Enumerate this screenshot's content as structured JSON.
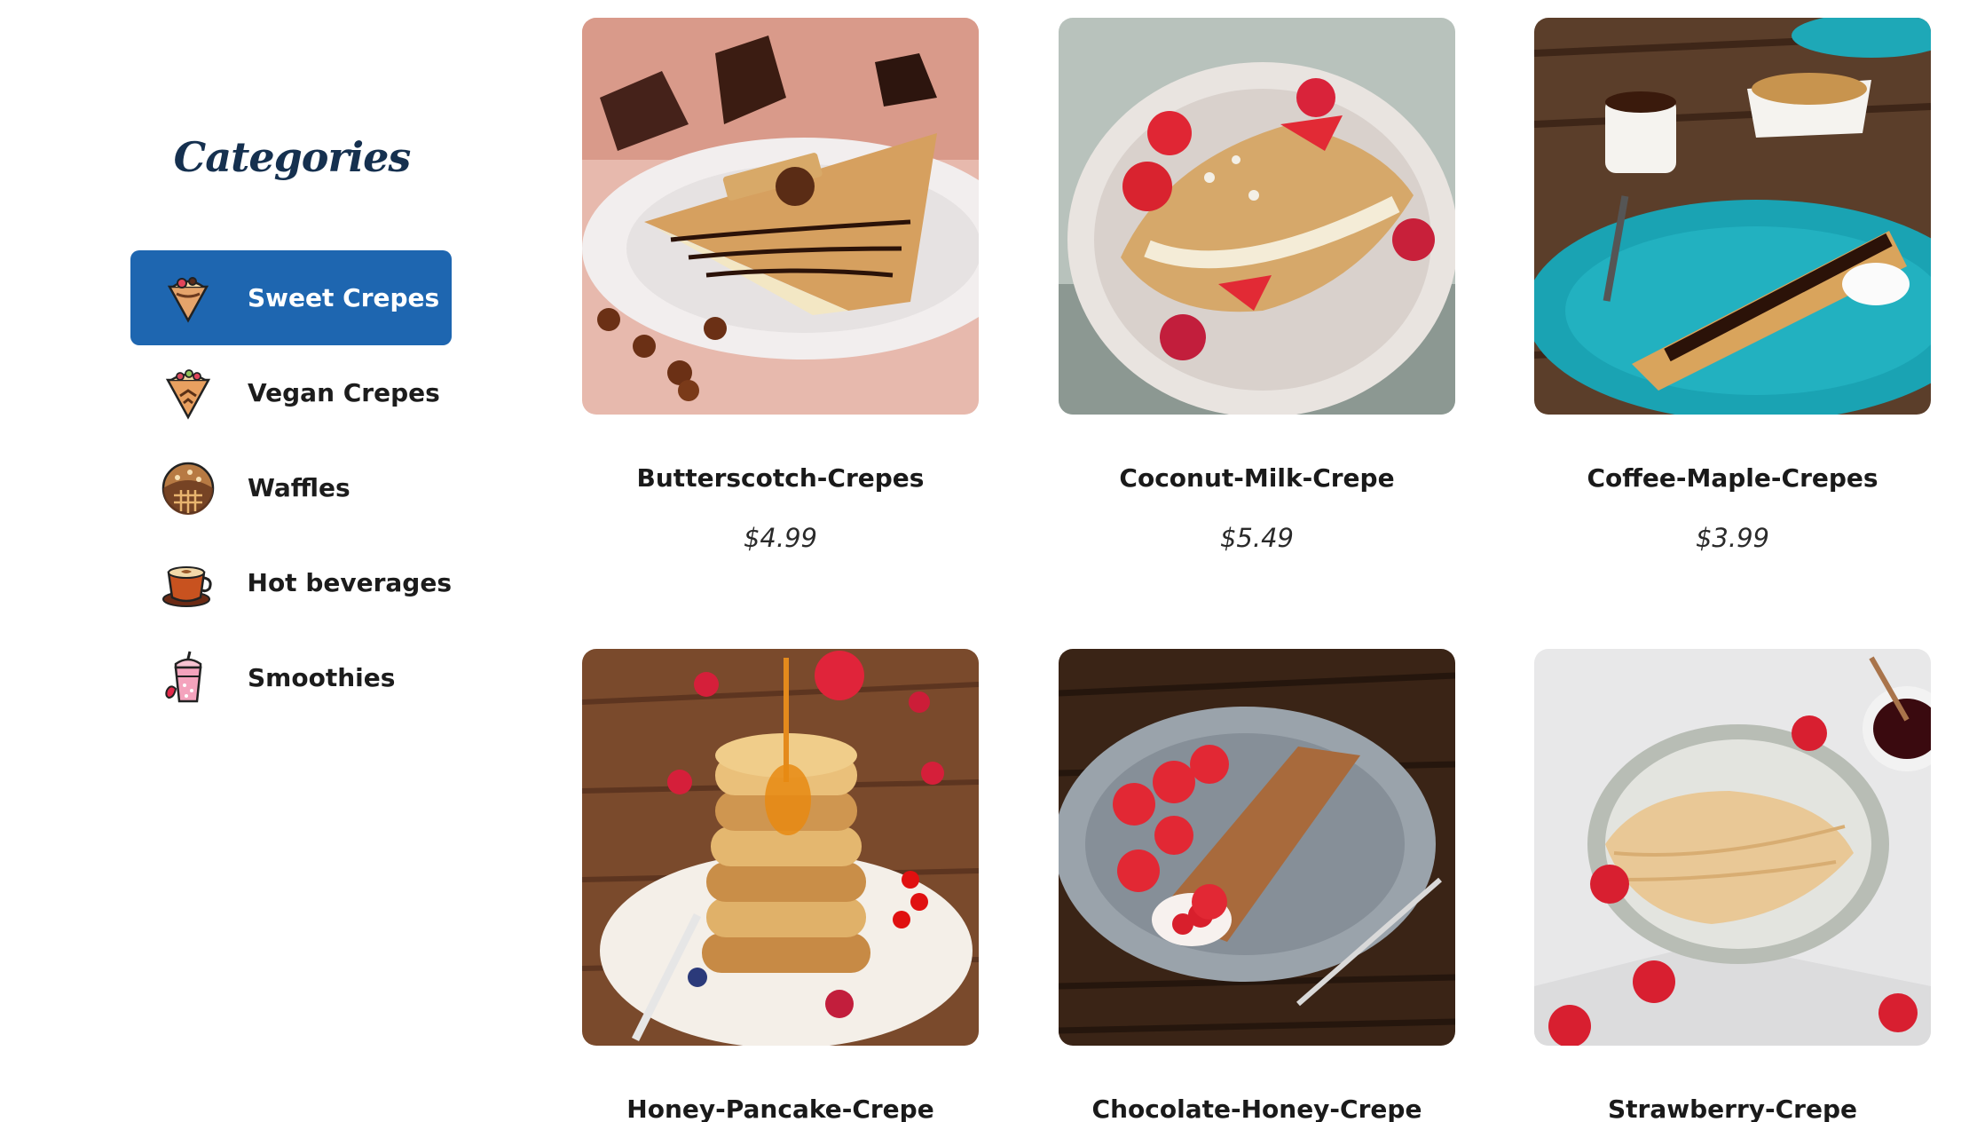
{
  "sidebar": {
    "title": "Categories",
    "items": [
      {
        "label": "Sweet Crepes",
        "icon": "sweet-crepe-icon",
        "active": true
      },
      {
        "label": "Vegan Crepes",
        "icon": "vegan-crepe-icon",
        "active": false
      },
      {
        "label": "Waffles",
        "icon": "waffle-icon",
        "active": false
      },
      {
        "label": "Hot beverages",
        "icon": "hot-beverage-icon",
        "active": false
      },
      {
        "label": "Smoothies",
        "icon": "smoothie-icon",
        "active": false
      }
    ]
  },
  "products": [
    {
      "name": "Butterscotch-Crepes",
      "price": "$4.99"
    },
    {
      "name": "Coconut-Milk-Crepe",
      "price": "$5.49"
    },
    {
      "name": "Coffee-Maple-Crepes",
      "price": "$3.99"
    },
    {
      "name": "Honey-Pancake-Crepe",
      "price": ""
    },
    {
      "name": "Chocolate-Honey-Crepe",
      "price": ""
    },
    {
      "name": "Strawberry-Crepe",
      "price": ""
    }
  ],
  "colors": {
    "active_category_bg": "#1e66b0",
    "title": "#15304f"
  }
}
